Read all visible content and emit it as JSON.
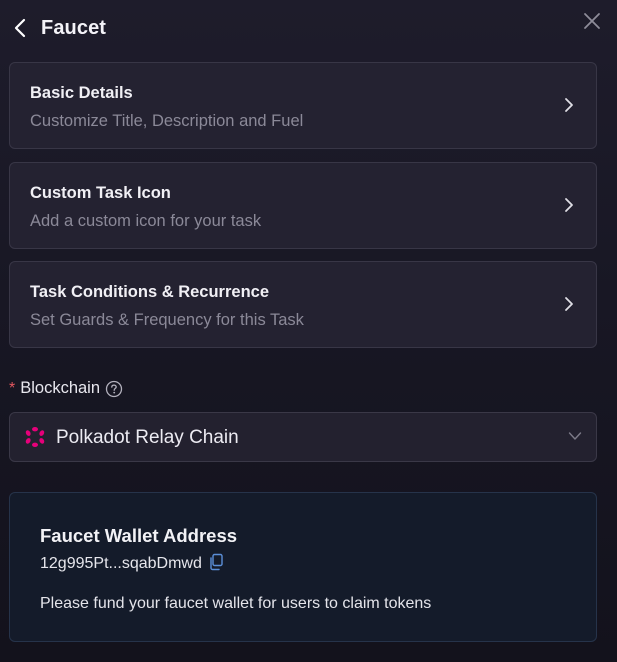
{
  "header": {
    "title": "Faucet",
    "back_icon": "chevron-left-icon",
    "close_icon": "close-icon"
  },
  "sections": [
    {
      "title": "Basic Details",
      "subtitle": "Customize Title, Description and Fuel",
      "icon": "chevron-right-icon"
    },
    {
      "title": "Custom Task Icon",
      "subtitle": "Add a custom icon for your task",
      "icon": "chevron-right-icon"
    },
    {
      "title": "Task Conditions & Recurrence",
      "subtitle": "Set Guards & Frequency for this Task",
      "icon": "chevron-right-icon"
    }
  ],
  "blockchain": {
    "required_mark": "*",
    "label": "Blockchain",
    "help_icon": "question-circle-icon",
    "selected": "Polkadot Relay Chain",
    "selected_icon": "polkadot-logo-icon",
    "dropdown_icon": "chevron-down-icon"
  },
  "wallet": {
    "title": "Faucet Wallet Address",
    "address": "12g995Pt...sqabDmwd",
    "copy_icon": "copy-icon",
    "note": "Please fund your faucet wallet for users to claim tokens"
  },
  "colors": {
    "background": "#1a1926",
    "card": "#242231",
    "card_border": "#383646",
    "subtitle_text": "#8b8998",
    "required_star": "#e4575f",
    "polkadot_pink": "#e6007a",
    "wallet_panel": "#141b2a",
    "wallet_border": "#26334a"
  }
}
